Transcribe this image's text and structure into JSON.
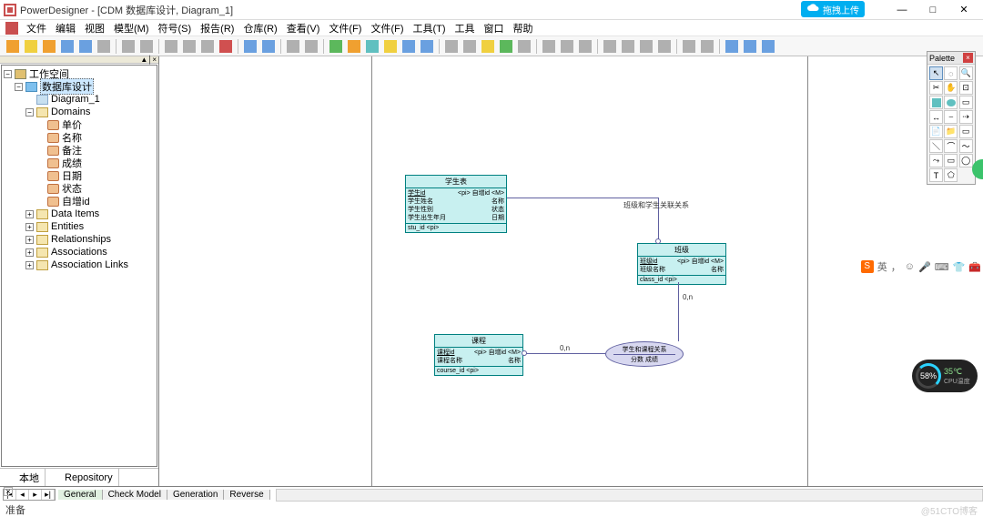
{
  "titlebar": {
    "title": "PowerDesigner - [CDM 数据库设计, Diagram_1]",
    "upload_label": "拖拽上传"
  },
  "menu": {
    "items": [
      "文件",
      "编辑",
      "视图",
      "模型(M)",
      "符号(S)",
      "报告(R)",
      "仓库(R)",
      "查看(V)",
      "文件(F)",
      "文件(F)",
      "工具(T)",
      "工具",
      "窗口",
      "帮助"
    ]
  },
  "toolbar": {
    "groups": [
      [
        "new-icon",
        "open-icon",
        "new-model-icon",
        "save-icon",
        "save-all-icon",
        "print-icon"
      ],
      [
        "properties-icon",
        "find-icon"
      ],
      [
        "cut-icon",
        "copy-icon",
        "paste-icon",
        "delete-icon"
      ],
      [
        "undo-icon",
        "redo-icon"
      ],
      [
        "zoom-icon",
        "zoom-dropdown-icon"
      ],
      [
        "check-icon",
        "generate-icon",
        "db-icon",
        "report-icon",
        "compare-icon",
        "merge-icon"
      ],
      [
        "attr-icon",
        "link-icon",
        "pencil-icon",
        "text-tool-icon",
        "font-icon"
      ],
      [
        "align-left-icon",
        "align-center-icon",
        "align-right-icon"
      ],
      [
        "layout1-icon",
        "layout2-icon",
        "layout3-icon",
        "layout4-icon"
      ],
      [
        "grid1-icon",
        "grid2-icon"
      ],
      [
        "view1-icon",
        "view2-icon",
        "view3-icon"
      ]
    ]
  },
  "sidebar": {
    "workspace": "工作空间",
    "model": "数据库设计",
    "diagram": "Diagram_1",
    "domains_label": "Domains",
    "domains": [
      "单价",
      "名称",
      "备注",
      "成绩",
      "日期",
      "状态",
      "自增id"
    ],
    "folders": [
      "Data Items",
      "Entities",
      "Relationships",
      "Associations",
      "Association Links"
    ],
    "tab_local": "本地",
    "tab_repo": "Repository"
  },
  "palette": {
    "title": "Palette",
    "tools": [
      "pointer",
      "lasso",
      "zoom",
      "cut",
      "grabber",
      "zoom-area",
      "entity",
      "association",
      "inheritance",
      "relationship",
      "link",
      "assoc-link",
      "file",
      "package",
      "note",
      "line",
      "arc",
      "polyline",
      "curve",
      "rect",
      "ellipse",
      "text",
      "polygon"
    ]
  },
  "diagram": {
    "student": {
      "title": "学生表",
      "attrs_left": [
        "学生id",
        "学生姓名",
        "学生性别",
        "学生出生年月"
      ],
      "attrs_right": [
        "<pi> 自增id <M>",
        "名称",
        "状态",
        "日期"
      ],
      "foot": "stu_id  <pi>"
    },
    "class": {
      "title": "班级",
      "attrs_left": [
        "班级id",
        "班级名称"
      ],
      "attrs_right": [
        "<pi> 自增id <M>",
        "名称"
      ],
      "foot": "class_id  <pi>"
    },
    "course": {
      "title": "课程",
      "attrs_left": [
        "课程id",
        "课程名称"
      ],
      "attrs_right": [
        "<pi> 自增id <M>",
        "名称"
      ],
      "foot": "course_id  <pi>"
    },
    "assoc": {
      "title": "学生和课程关系",
      "body": "分数  成绩"
    },
    "rel_label": "班级和学生关联关系",
    "card_0n_a": "0,n",
    "card_0n_b": "0,n"
  },
  "ime": {
    "label": "英",
    "punct": "，"
  },
  "cpu": {
    "pct": "58%",
    "temp": "35℃",
    "label": "CPU温度"
  },
  "bottom_tabs": [
    "General",
    "Check Model",
    "Generation",
    "Reverse"
  ],
  "status": "准备",
  "watermark": "@51CTO博客"
}
